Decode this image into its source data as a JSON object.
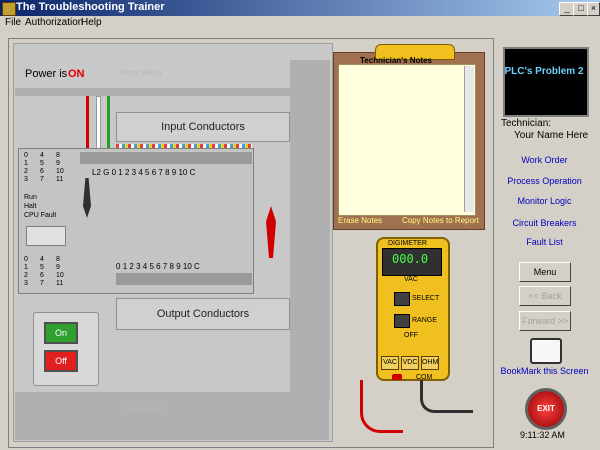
{
  "window": {
    "title": "The Troubleshooting Trainer",
    "minimize": "_",
    "maximize": "□",
    "close": "×"
  },
  "menu": [
    "File",
    "Authorization",
    "Help"
  ],
  "scene": {
    "power_label": "Power is",
    "power_state": "ON",
    "plastic_wiring": "Plastic Wiring",
    "input_conductors": "Input Conductors",
    "output_conductors": "Output Conductors",
    "input_terminals": [
      "L2",
      "G",
      "0",
      "1",
      "2",
      "3",
      "4",
      "5",
      "6",
      "7",
      "8",
      "9",
      "10",
      "C"
    ],
    "output_terminals": [
      "0",
      "1",
      "2",
      "3",
      "4",
      "5",
      "6",
      "7",
      "8",
      "9",
      "10",
      "C"
    ],
    "input_led_labels": [
      "0",
      "4",
      "8",
      "1",
      "5",
      "9",
      "2",
      "6",
      "10",
      "3",
      "7",
      "11"
    ],
    "status_leds": [
      "Run",
      "Halt",
      "CPU Fault"
    ],
    "output_led_labels": [
      "0",
      "4",
      "8",
      "1",
      "5",
      "9",
      "2",
      "6",
      "10",
      "3",
      "7",
      "11"
    ],
    "switch": {
      "on": "On",
      "off": "Off"
    }
  },
  "notes": {
    "title": "Technician's Notes",
    "erase": "Erase Notes",
    "copy": "Copy Notes to Report",
    "content": ""
  },
  "meter": {
    "brand": "DIGIMETER",
    "reading": "000.0",
    "unit": "VAC",
    "select": "SELECT",
    "range": "RANGE",
    "off": "OFF",
    "modes": [
      "VAC",
      "VDC",
      "OHM"
    ],
    "com": "COM"
  },
  "right_panel": {
    "problem_title": "PLC's Problem 2",
    "technician_label": "Technician:",
    "technician_name": "Your Name Here",
    "links": [
      "Work Order",
      "Process Operation",
      "Monitor Logic",
      "Circuit Breakers",
      "Fault List"
    ],
    "menu_button": "Menu",
    "back_button": "<< Back",
    "forward_button": "Forward >>",
    "bookmark": "BookMark this Screen",
    "exit": "EXIT",
    "time": "9:11:32 AM"
  },
  "colors": {
    "power_on": "#e00000",
    "problem_text": "#6fd0ff",
    "link": "#0000c0"
  }
}
